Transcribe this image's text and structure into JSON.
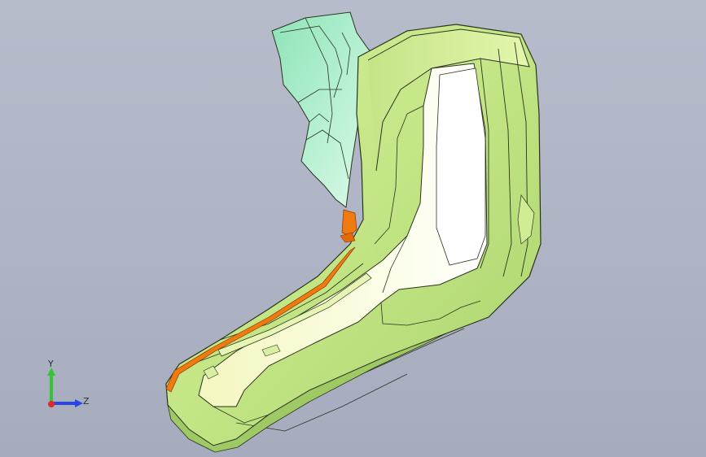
{
  "viewport": {
    "background_top": "#b7bccb",
    "background_bottom": "#a6acbd"
  },
  "model": {
    "colors": {
      "body_green": "#c9e88a",
      "highlight_yellow": "#f5f8c8",
      "inner_white": "#ffffff",
      "mint_part": "#a8ecc7",
      "edge_orange": "#f07a12",
      "outline": "#2b3320"
    }
  },
  "triad": {
    "y_label": "Y",
    "z_label": "Z",
    "y_color": "#36c436",
    "z_color": "#2a46e0",
    "x_color": "#e02a2a"
  }
}
